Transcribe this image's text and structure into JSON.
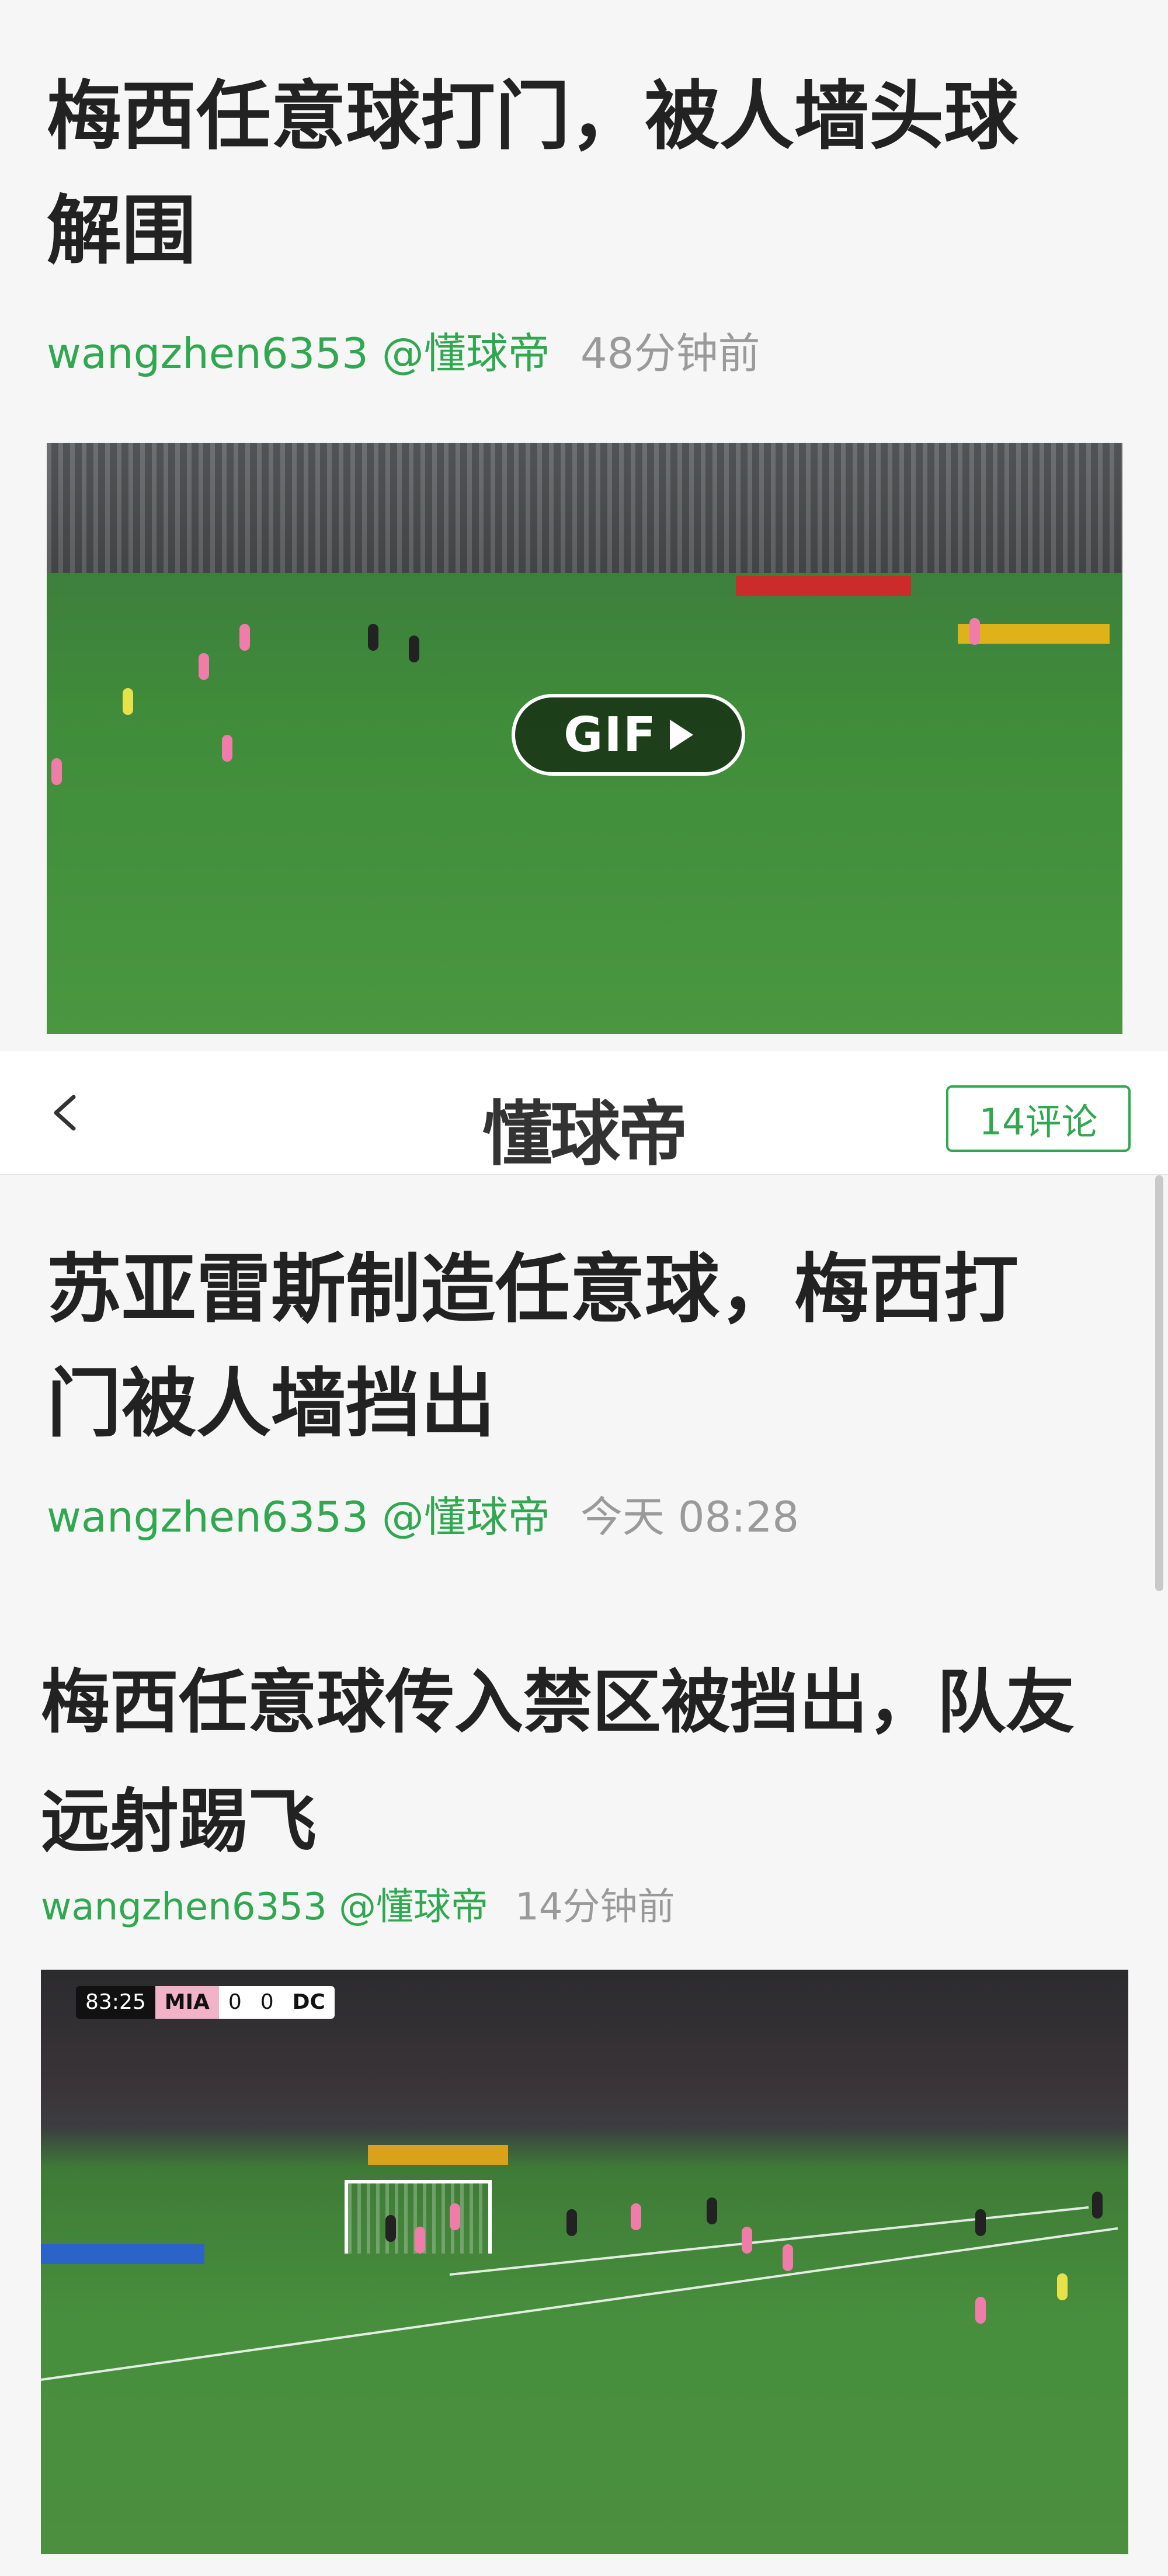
{
  "post1": {
    "title_line1": "梅西任意球打门，被人墙头球",
    "title_line2": "解围",
    "author": "wangzhen6353 @懂球帝",
    "time": "48分钟前",
    "media_badge": "GIF"
  },
  "navbar": {
    "brand": "懂球帝",
    "comments_button": "14评论"
  },
  "post2": {
    "title_line1": "苏亚雷斯制造任意球，梅西打",
    "title_line2": "门被人墙挡出",
    "author": "wangzhen6353 @懂球帝",
    "time": "今天 08:28"
  },
  "post3": {
    "title_line1": "梅西任意球传入禁区被挡出，队友",
    "title_line2": "远射踢飞",
    "author": "wangzhen6353 @懂球帝",
    "time": "14分钟前",
    "scoreboard": {
      "clock": "83:25",
      "home": "MIA",
      "home_score": "0",
      "away_score": "0",
      "away": "DC"
    }
  },
  "colors": {
    "accent_green": "#2fa84f",
    "title_text": "#222222",
    "meta_gray": "#9a9a9a",
    "background": "#f6f6f7"
  },
  "icons": [
    "chevron-left-icon",
    "play-icon"
  ]
}
